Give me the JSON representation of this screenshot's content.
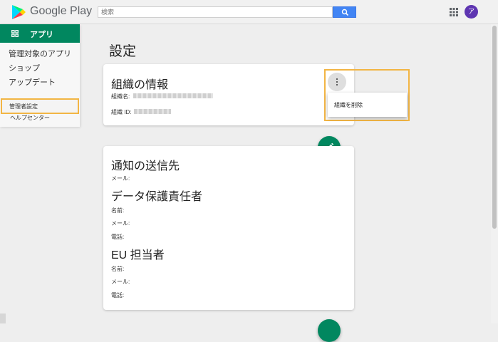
{
  "header": {
    "brand": "Google Play",
    "search_placeholder": "検索",
    "avatar_initial": "ア"
  },
  "sidebar": {
    "active_item": "アプリ",
    "items": [
      "管理対象のアプリ",
      "ショップ",
      "アップデート"
    ],
    "admin_settings": "管理者設定",
    "help_center": "ヘルプセンター"
  },
  "main": {
    "page_title": "設定",
    "org_card": {
      "title": "組織の情報",
      "org_name_label": "組織名:",
      "org_id_label": "組織 ID:",
      "menu_item": "組織を削除"
    },
    "contact_card": {
      "title": "通知の送信先",
      "email_label": "メール:",
      "dpo_title": "データ保護責任者",
      "dpo_name_label": "名前:",
      "dpo_email_label": "メール:",
      "dpo_phone_label": "電話:",
      "eu_title": "EU 担当者",
      "eu_name_label": "名前:",
      "eu_email_label": "メール:",
      "eu_phone_label": "電話:"
    }
  },
  "colors": {
    "accent_green": "#01875f",
    "highlight_orange": "#f2b544",
    "search_blue": "#4285f4",
    "avatar_purple": "#5e35b1"
  }
}
